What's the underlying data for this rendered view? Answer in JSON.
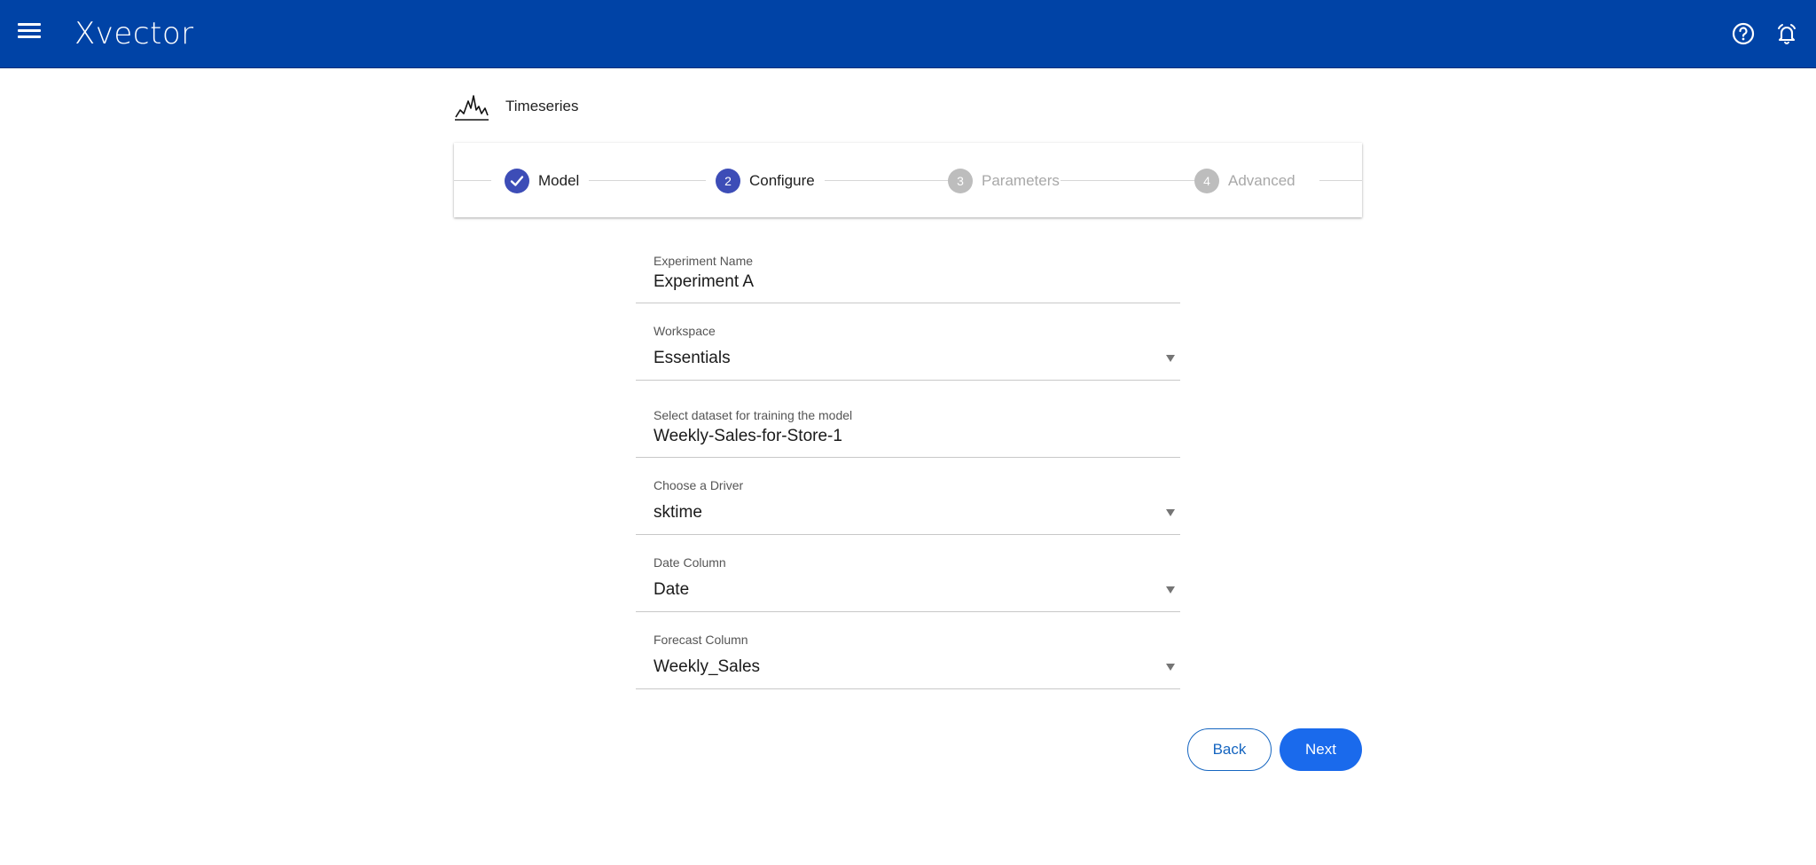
{
  "app": {
    "brand": "Xvector",
    "menu_icon": "hamburger-menu-icon",
    "help_icon": "help-circle-icon",
    "notifications_icon": "bell-alert-icon"
  },
  "page": {
    "title": "Timeseries",
    "title_icon": "timeseries-chart-icon"
  },
  "stepper": {
    "steps": [
      {
        "number": "",
        "label": "Model",
        "state": "completed"
      },
      {
        "number": "2",
        "label": "Configure",
        "state": "active"
      },
      {
        "number": "3",
        "label": "Parameters",
        "state": "inactive"
      },
      {
        "number": "4",
        "label": "Advanced",
        "state": "inactive"
      }
    ]
  },
  "form": {
    "experiment_name": {
      "label": "Experiment Name",
      "value": "Experiment A"
    },
    "workspace": {
      "label": "Workspace",
      "value": "Essentials"
    },
    "dataset": {
      "label": "Select dataset for training the model",
      "value": "Weekly-Sales-for-Store-1"
    },
    "driver": {
      "label": "Choose a Driver",
      "value": "sktime"
    },
    "date_column": {
      "label": "Date Column",
      "value": "Date"
    },
    "forecast_column": {
      "label": "Forecast Column",
      "value": "Weekly_Sales"
    }
  },
  "actions": {
    "back_label": "Back",
    "next_label": "Next"
  },
  "colors": {
    "topbar": "#0043a6",
    "step_active": "#3d4db7",
    "step_inactive": "#bdbdbd",
    "primary_button": "#1a6aec",
    "outline_button": "#1565c0"
  }
}
